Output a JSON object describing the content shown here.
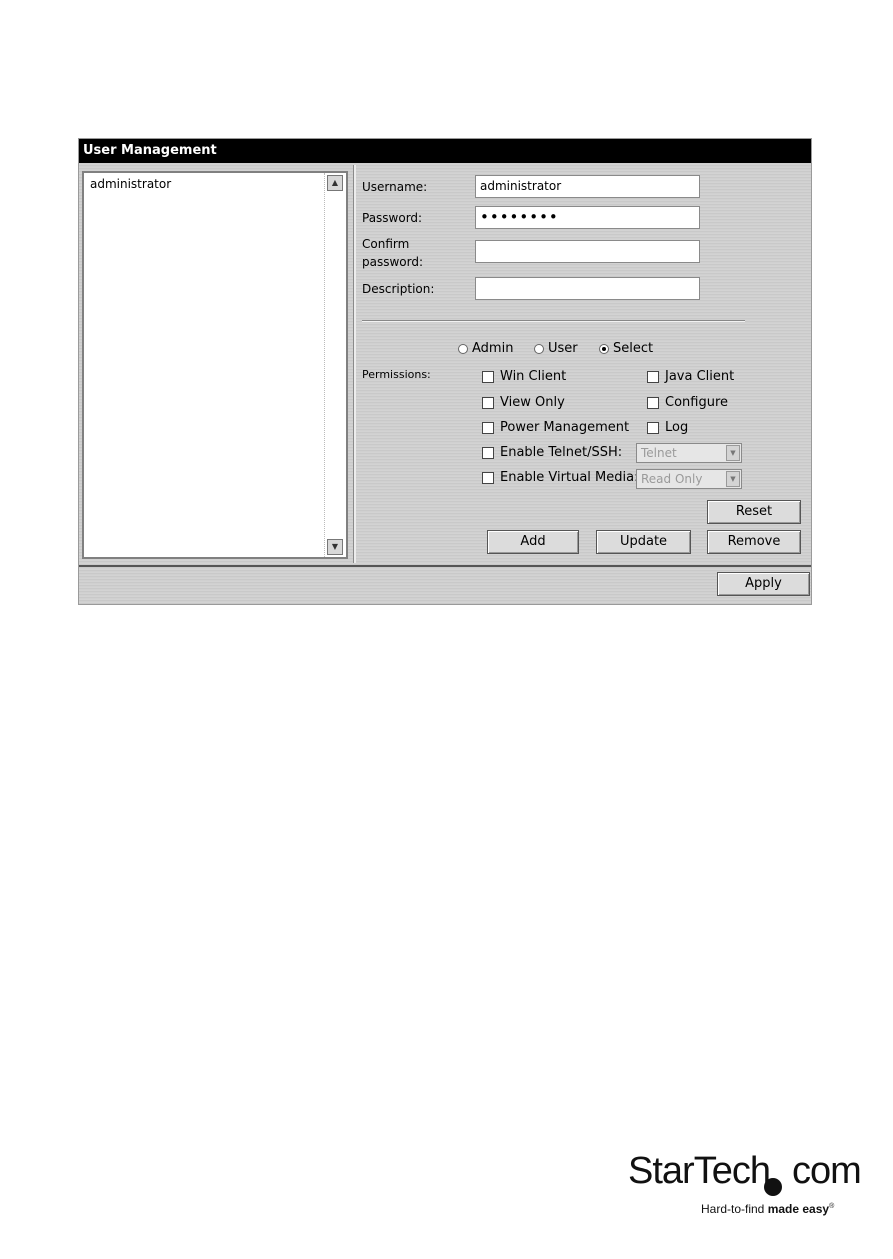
{
  "window": {
    "title": "User Management"
  },
  "user_list": {
    "items": [
      "administrator"
    ]
  },
  "form": {
    "username_label": "Username:",
    "username_value": "administrator",
    "password_label": "Password:",
    "password_value": "••••••••",
    "confirm_label_1": "Confirm",
    "confirm_label_2": "password:",
    "confirm_value": "",
    "description_label": "Description:",
    "description_value": ""
  },
  "roles": {
    "options": [
      "Admin",
      "User",
      "Select"
    ],
    "selected": "Select"
  },
  "permissions": {
    "label": "Permissions:",
    "win_client": "Win Client",
    "java_client": "Java Client",
    "view_only": "View Only",
    "configure": "Configure",
    "power_management": "Power Management",
    "log": "Log",
    "enable_telnet": "Enable Telnet/SSH:",
    "telnet_option": "Telnet",
    "enable_virtual_media": "Enable Virtual Media:",
    "virtual_media_option": "Read Only"
  },
  "buttons": {
    "reset": "Reset",
    "add": "Add",
    "update": "Update",
    "remove": "Remove",
    "apply": "Apply"
  },
  "branding": {
    "logo_word": "StarTech",
    "logo_suffix": "com",
    "tagline_plain": "Hard-to-find ",
    "tagline_bold": "made easy",
    "trademark": "®"
  }
}
